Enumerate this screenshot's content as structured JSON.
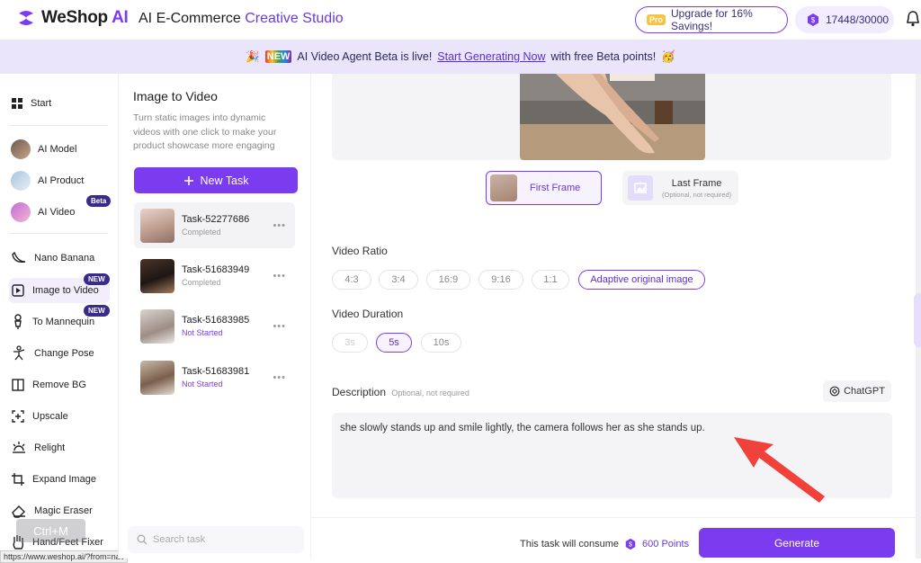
{
  "header": {
    "logo_main": "WeShop",
    "logo_ai": "AI",
    "studio_prefix": "AI E-Commerce ",
    "studio_suffix": "Creative Studio",
    "pro_badge": "Pro",
    "upgrade_label": "Upgrade for 16% Savings!",
    "points_value": "17448/30000"
  },
  "banner": {
    "emoji_left": "🎉",
    "new_tag": "NEW",
    "text_before": "AI Video Agent Beta is live!",
    "link": "Start Generating Now",
    "text_after": "with free Beta points!",
    "emoji_right": "🥳"
  },
  "sidebar": {
    "items": [
      {
        "label": "Start"
      },
      {
        "label": "AI Model"
      },
      {
        "label": "AI Product"
      },
      {
        "label": "AI Video",
        "badge": "Beta"
      },
      {
        "label": "Nano Banana"
      },
      {
        "label": "Image to Video",
        "badge": "NEW"
      },
      {
        "label": "To Mannequin",
        "badge": "NEW"
      },
      {
        "label": "Change Pose"
      },
      {
        "label": "Remove BG"
      },
      {
        "label": "Upscale"
      },
      {
        "label": "Relight"
      },
      {
        "label": "Expand Image"
      },
      {
        "label": "Magic Eraser"
      },
      {
        "label": "Hand/Feet Fixer"
      }
    ],
    "shortcut_overlay": "Ctrl+M",
    "status_url": "https://www.weshop.ai/?from=nav"
  },
  "tasks": {
    "title": "Image to Video",
    "description": "Turn static images into dynamic videos with one click to make your product showcase more engaging",
    "new_task_label": "New Task",
    "list": [
      {
        "name": "Task-52277686",
        "status": "Completed"
      },
      {
        "name": "Task-51683949",
        "status": "Completed"
      },
      {
        "name": "Task-51683985",
        "status": "Not Started"
      },
      {
        "name": "Task-51683981",
        "status": "Not Started"
      }
    ],
    "search_placeholder": "Search task"
  },
  "main": {
    "first_frame_label": "First Frame",
    "last_frame_label": "Last Frame",
    "last_frame_note": "(Optional, not required)",
    "ratio_label": "Video Ratio",
    "ratios": [
      "4:3",
      "3:4",
      "16:9",
      "9:16",
      "1:1",
      "Adaptive original image"
    ],
    "ratio_selected": "Adaptive original image",
    "duration_label": "Video Duration",
    "durations": [
      "3s",
      "5s",
      "10s"
    ],
    "duration_selected": "5s",
    "description_label": "Description",
    "description_note": "Optional, not required",
    "chatgpt_label": "ChatGPT",
    "description_text": "she slowly stands up and smile lightly, the camera follows her as she stands up."
  },
  "footer": {
    "consume_text": "This task will consume",
    "consume_points": "600 Points",
    "generate_label": "Generate"
  },
  "colors": {
    "accent": "#7b3cf0",
    "banner_bg": "#ebe5fb",
    "annotation_arrow": "#f0413a"
  }
}
